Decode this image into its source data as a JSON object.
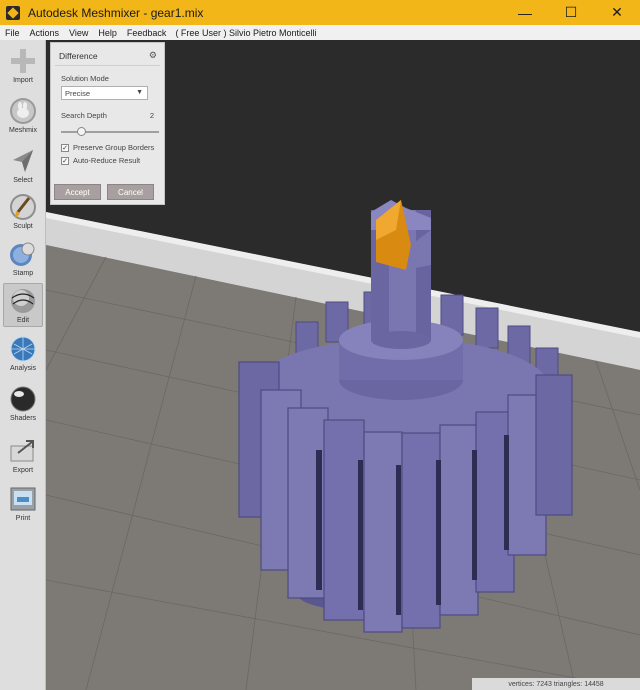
{
  "window": {
    "title": "Autodesk Meshmixer - gear1.mix",
    "minimize_glyph": "—",
    "maximize_glyph": "☐",
    "close_glyph": "✕"
  },
  "menu": {
    "items": [
      "File",
      "Actions",
      "View",
      "Help",
      "Feedback"
    ],
    "user_info": "( Free User ) Silvio Pietro Monticelli"
  },
  "toolbar": {
    "tools": [
      {
        "label": "Import",
        "icon": "plus-icon",
        "active": false
      },
      {
        "label": "Meshmix",
        "icon": "meshmix-bunny-icon",
        "active": false
      },
      {
        "label": "Select",
        "icon": "arrow-cursor-icon",
        "active": false
      },
      {
        "label": "Sculpt",
        "icon": "brush-icon",
        "active": false
      },
      {
        "label": "Stamp",
        "icon": "stamp-icon",
        "active": false
      },
      {
        "label": "Edit",
        "icon": "edit-sphere-icon",
        "active": true
      },
      {
        "label": "Analysis",
        "icon": "analysis-sphere-icon",
        "active": false
      },
      {
        "label": "Shaders",
        "icon": "shader-sphere-icon",
        "active": false
      },
      {
        "label": "Export",
        "icon": "export-icon",
        "active": false
      },
      {
        "label": "Print",
        "icon": "printer-icon",
        "active": false
      }
    ]
  },
  "panel": {
    "title": "Difference",
    "solution_mode_label": "Solution Mode",
    "solution_mode_value": "Precise",
    "search_depth_label": "Search Depth",
    "search_depth_value": "2",
    "search_depth_level": 0.2,
    "preserve_borders_label": "Preserve Group Borders",
    "preserve_borders_checked": true,
    "auto_reduce_label": "Auto-Reduce Result",
    "auto_reduce_checked": true,
    "accept_label": "Accept",
    "cancel_label": "Cancel"
  },
  "status": {
    "text": "vertices: 7243 triangles: 14458"
  },
  "colors": {
    "title_bar": "#f2b619",
    "mesh": "#7a76b0",
    "mesh_dark": "#5a5690",
    "highlight": "#d98a10",
    "floor": "#7d7a76",
    "background": "#2b2b2b"
  }
}
